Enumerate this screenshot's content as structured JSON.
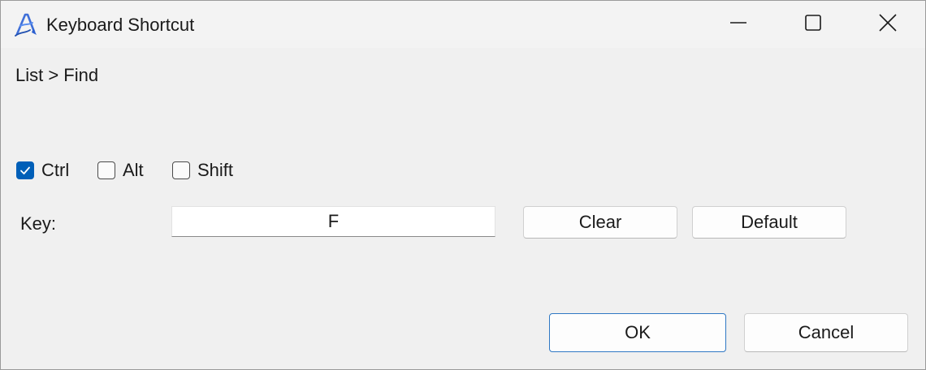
{
  "window": {
    "title": "Keyboard Shortcut",
    "app_icon": "app-pen-logo-icon",
    "controls": [
      "minimize-icon",
      "maximize-icon",
      "close-icon"
    ]
  },
  "breadcrumb": "List > Find",
  "modifiers": [
    {
      "label": "Ctrl",
      "checked": true
    },
    {
      "label": "Alt",
      "checked": false
    },
    {
      "label": "Shift",
      "checked": false
    }
  ],
  "key": {
    "label": "Key:",
    "value": "F"
  },
  "buttons": {
    "clear": "Clear",
    "default": "Default",
    "ok": "OK",
    "cancel": "Cancel"
  },
  "colors": {
    "accent": "#005fb8",
    "background": "#f0f0f0"
  }
}
